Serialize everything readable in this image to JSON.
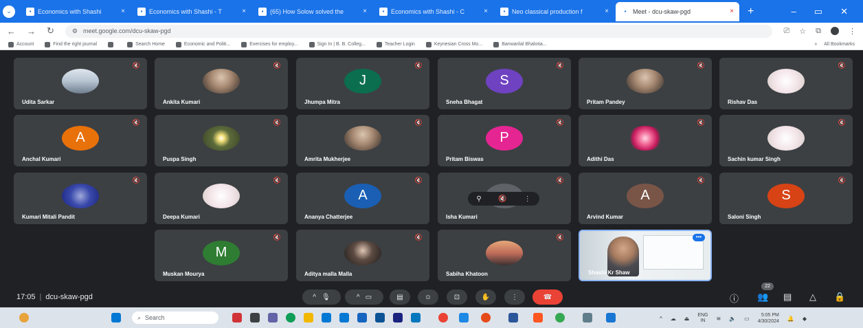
{
  "browser": {
    "tabs": [
      {
        "label": "Economics with Shashi",
        "active": false
      },
      {
        "label": "Economics with Shashi - T",
        "active": false
      },
      {
        "label": "(65) How Solow solved the",
        "active": false
      },
      {
        "label": "Economics with Shashi - C",
        "active": false
      },
      {
        "label": "Neo classical production f",
        "active": false
      },
      {
        "label": "Meet - dcu-skaw-pgd",
        "active": true
      }
    ],
    "url": "meet.google.com/dcu-skaw-pgd",
    "bookmarks": [
      "Account",
      "Find the right journal",
      "",
      "Search Home",
      "Economic and Politi...",
      "Exercises for employ...",
      "Sign In | B. B. Colleg...",
      "Teacher Login",
      "Keynesian Cross Mo...",
      "Banwarilal Bhalotia..."
    ],
    "all_bookmarks": "All Bookmarks"
  },
  "participants": [
    {
      "name": "Udita Sarkar",
      "style": "photo-sky",
      "initial": ""
    },
    {
      "name": "Ankita Kumari",
      "style": "photo",
      "initial": ""
    },
    {
      "name": "Jhumpa Mitra",
      "style": "",
      "initial": "J",
      "color": "#0b6e4f"
    },
    {
      "name": "Sneha Bhagat",
      "style": "",
      "initial": "S",
      "color": "#6f42c1"
    },
    {
      "name": "Pritam Pandey",
      "style": "photo",
      "initial": ""
    },
    {
      "name": "Rishav Das",
      "style": "photo-light",
      "initial": ""
    },
    {
      "name": "Anchal Kumari",
      "style": "",
      "initial": "A",
      "color": "#e8710a"
    },
    {
      "name": "Puspa Singh",
      "style": "photo-flower",
      "initial": ""
    },
    {
      "name": "Amrita Mukherjee",
      "style": "photo",
      "initial": ""
    },
    {
      "name": "Pritam Biswas",
      "style": "",
      "initial": "P",
      "color": "#e52592"
    },
    {
      "name": "Adithi Das",
      "style": "photo-pink",
      "initial": ""
    },
    {
      "name": "Sachin kumar Singh",
      "style": "photo-light",
      "initial": ""
    },
    {
      "name": "Kumari Mitali Pandit",
      "style": "photo-blue",
      "initial": ""
    },
    {
      "name": "Deepa Kumari",
      "style": "photo-light",
      "initial": ""
    },
    {
      "name": "Ananya Chatterjee",
      "style": "",
      "initial": "A",
      "color": "#1a5fb4"
    },
    {
      "name": "Isha Kumari",
      "style": "",
      "initial": "",
      "color": "#5f6368"
    },
    {
      "name": "Arvind Kumar",
      "style": "",
      "initial": "A",
      "color": "#795548"
    },
    {
      "name": "Saloni Singh",
      "style": "",
      "initial": "S",
      "color": "#d84315"
    },
    {
      "name": "Muskan Mourya",
      "style": "",
      "initial": "M",
      "color": "#2e7d32"
    },
    {
      "name": "Aditya malla Malla",
      "style": "photo-dark",
      "initial": ""
    },
    {
      "name": "Sabiha Khatoon",
      "style": "photo-sunset",
      "initial": ""
    },
    {
      "name": "Shashi Kr Shaw",
      "style": "speaker",
      "initial": ""
    }
  ],
  "meeting": {
    "time": "17:05",
    "code": "dcu-skaw-pgd",
    "participant_count": "22"
  },
  "taskbar": {
    "search_placeholder": "Search",
    "lang_top": "ENG",
    "lang_bottom": "IN",
    "clock_time": "5:05 PM",
    "clock_date": "4/30/2024"
  },
  "colors": {
    "accent": "#1a73e8",
    "end_call": "#ea4335",
    "tile_bg": "#3c4043",
    "page_bg": "#202124"
  }
}
